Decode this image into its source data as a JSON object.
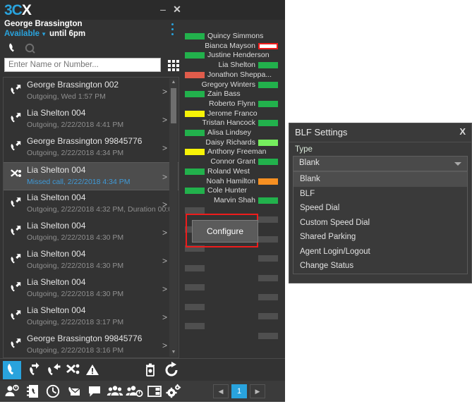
{
  "window": {
    "logo_3": "3C",
    "logo_x": "X",
    "minimize": "–",
    "close": "✕"
  },
  "presence": {
    "user_name": "George Brassington",
    "status": "Available",
    "caret": "▼",
    "until": "until 6pm"
  },
  "search": {
    "placeholder": "Enter Name or Number...",
    "value": ""
  },
  "call_list": {
    "rows": [
      {
        "name": "George Brassington 002",
        "detail": "Outgoing, Wed 1:57 PM",
        "type": "outgoing",
        "arrow": ">"
      },
      {
        "name": "Lia Shelton 004",
        "detail": "Outgoing, 2/22/2018 4:41 PM",
        "type": "outgoing",
        "arrow": ">"
      },
      {
        "name": "George Brassington 99845776",
        "detail": "Outgoing, 2/22/2018 4:34 PM",
        "type": "outgoing",
        "arrow": ">"
      },
      {
        "name": "Lia Shelton 004",
        "detail": "Missed call, 2/22/2018 4:34 PM",
        "type": "missed",
        "arrow": ">"
      },
      {
        "name": "Lia Shelton 004",
        "detail": "Outgoing, 2/22/2018 4:32 PM, Duration 00:0...",
        "type": "outgoing",
        "arrow": ">"
      },
      {
        "name": "Lia Shelton 004",
        "detail": "Outgoing, 2/22/2018 4:30 PM",
        "type": "outgoing",
        "arrow": ">"
      },
      {
        "name": "Lia Shelton 004",
        "detail": "Outgoing, 2/22/2018 4:30 PM",
        "type": "outgoing",
        "arrow": ">"
      },
      {
        "name": "Lia Shelton 004",
        "detail": "Outgoing, 2/22/2018 4:30 PM",
        "type": "outgoing",
        "arrow": ">"
      },
      {
        "name": "Lia Shelton 004",
        "detail": "Outgoing, 2/22/2018 3:17 PM",
        "type": "outgoing",
        "arrow": ">"
      },
      {
        "name": "George Brassington 99845776",
        "detail": "Outgoing, 2/22/2018 3:16 PM",
        "type": "outgoing",
        "arrow": ">"
      }
    ],
    "selected_index": 3,
    "scroll_up": "▲",
    "scroll_down": "▼"
  },
  "blf": {
    "colors": {
      "green": "#22b14c",
      "light_green": "#76ee5e",
      "yellow": "#f7f307",
      "orange": "#f79022",
      "red": "#e05c4b",
      "red_outline": "#ee1c1c",
      "empty": "#4f4f4f"
    },
    "slots": [
      {
        "name": "Quincy Simmons",
        "side": "left",
        "status": "green"
      },
      {
        "name": "Bianca Mayson",
        "side": "right",
        "status": "red_outline"
      },
      {
        "name": "Justine Henderson",
        "side": "left",
        "status": "green"
      },
      {
        "name": "Lia Shelton",
        "side": "right",
        "status": "green"
      },
      {
        "name": "Jonathon Sheppa...",
        "side": "left",
        "status": "red"
      },
      {
        "name": "Gregory Winters",
        "side": "right",
        "status": "green"
      },
      {
        "name": "Zain Bass",
        "side": "left",
        "status": "green"
      },
      {
        "name": "Roberto Flynn",
        "side": "right",
        "status": "green"
      },
      {
        "name": "Jerome Franco",
        "side": "left",
        "status": "yellow"
      },
      {
        "name": "Tristan Hancock",
        "side": "right",
        "status": "green"
      },
      {
        "name": "Alisa Lindsey",
        "side": "left",
        "status": "green"
      },
      {
        "name": "Daisy Richards",
        "side": "right",
        "status": "light_green"
      },
      {
        "name": "Anthony Freeman",
        "side": "left",
        "status": "yellow"
      },
      {
        "name": "Connor Grant",
        "side": "right",
        "status": "green"
      },
      {
        "name": "Roland West",
        "side": "left",
        "status": "green"
      },
      {
        "name": "Noah Hamilton",
        "side": "right",
        "status": "orange"
      },
      {
        "name": "Cole Hunter",
        "side": "left",
        "status": "green"
      },
      {
        "name": "Marvin Shah",
        "side": "right",
        "status": "green"
      },
      {
        "name": "",
        "side": "left",
        "status": "empty"
      },
      {
        "name": "",
        "side": "right",
        "status": "empty"
      },
      {
        "name": "",
        "side": "left",
        "status": "empty"
      },
      {
        "name": "",
        "side": "right",
        "status": "empty"
      },
      {
        "name": "",
        "side": "left",
        "status": "empty"
      },
      {
        "name": "",
        "side": "right",
        "status": "empty"
      },
      {
        "name": "",
        "side": "left",
        "status": "empty"
      },
      {
        "name": "",
        "side": "right",
        "status": "empty"
      },
      {
        "name": "",
        "side": "left",
        "status": "empty"
      },
      {
        "name": "",
        "side": "right",
        "status": "empty"
      },
      {
        "name": "",
        "side": "left",
        "status": "empty"
      },
      {
        "name": "",
        "side": "right",
        "status": "empty"
      },
      {
        "name": "",
        "side": "left",
        "status": "empty"
      },
      {
        "name": "",
        "side": "right",
        "status": "empty"
      }
    ],
    "configure_label": "Configure"
  },
  "pager": {
    "prev": "◀",
    "current": "1",
    "next": "▶"
  },
  "dialog": {
    "title": "BLF Settings",
    "close": "X",
    "type_label": "Type",
    "selected": "Blank",
    "options": [
      "Blank",
      "BLF",
      "Speed Dial",
      "Custom Speed Dial",
      "Shared Parking",
      "Agent Login/Logout",
      "Change Status"
    ],
    "selected_option_index": 0
  },
  "toolbar_top": [
    {
      "icon": "phone-icon",
      "active": true
    },
    {
      "icon": "call-forward-icon",
      "active": false
    },
    {
      "icon": "call-transfer-icon",
      "active": false
    },
    {
      "icon": "conference-icon",
      "active": false
    },
    {
      "icon": "alert-icon",
      "active": false
    },
    {
      "icon": "trash-icon",
      "active": false
    },
    {
      "icon": "refresh-icon",
      "active": false
    }
  ],
  "toolbar_bottom": [
    {
      "icon": "presence-user-icon"
    },
    {
      "icon": "contacts-book-icon"
    },
    {
      "icon": "call-history-icon"
    },
    {
      "icon": "voicemail-icon"
    },
    {
      "icon": "chat-icon"
    },
    {
      "icon": "group-icon"
    },
    {
      "icon": "group-status-icon"
    },
    {
      "icon": "panel-layout-icon"
    },
    {
      "icon": "settings-gear-icon"
    }
  ]
}
